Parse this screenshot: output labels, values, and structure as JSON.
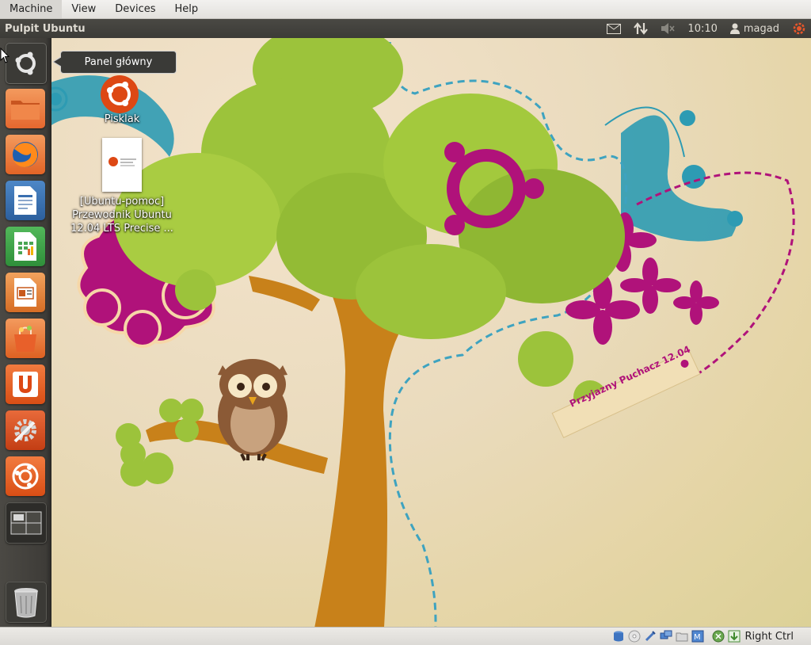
{
  "vbox_menu": {
    "items": [
      "Machine",
      "View",
      "Devices",
      "Help"
    ]
  },
  "top_panel": {
    "title": "Pulpit Ubuntu",
    "clock": "10:10",
    "user": "magad"
  },
  "launcher": {
    "tooltip": "Panel główny",
    "items": [
      {
        "name": "dash-home",
        "icon": "ubuntu-logo-icon"
      },
      {
        "name": "files",
        "icon": "folder-icon"
      },
      {
        "name": "firefox",
        "icon": "firefox-icon"
      },
      {
        "name": "libreoffice-writer",
        "icon": "writer-icon"
      },
      {
        "name": "libreoffice-calc",
        "icon": "calc-icon"
      },
      {
        "name": "libreoffice-impress",
        "icon": "impress-icon"
      },
      {
        "name": "software-center",
        "icon": "shopping-bag-icon"
      },
      {
        "name": "ubuntu-one",
        "icon": "ubuntu-one-icon"
      },
      {
        "name": "system-settings",
        "icon": "settings-icon"
      },
      {
        "name": "ubuntu-help",
        "icon": "help-icon"
      },
      {
        "name": "workspace-switcher",
        "icon": "workspaces-icon"
      },
      {
        "name": "trash",
        "icon": "trash-icon"
      }
    ]
  },
  "desktop": {
    "icons": [
      {
        "label": "Pisklak"
      },
      {
        "label_lines": [
          "[Ubuntu-pomoc]",
          "Przewodnik Ubuntu",
          "12.04 LTS Precise ..."
        ]
      }
    ],
    "wallpaper_tag": "Przyjazny Puchacz 12.04"
  },
  "vbox_status": {
    "host_key": "Right Ctrl"
  },
  "colors": {
    "panel": "#3c3b37",
    "ubuntu_orange": "#dd4814",
    "leaf_green": "#9cc33b",
    "magenta": "#b0127a",
    "teal": "#2d9bb3",
    "trunk": "#c8811a"
  }
}
